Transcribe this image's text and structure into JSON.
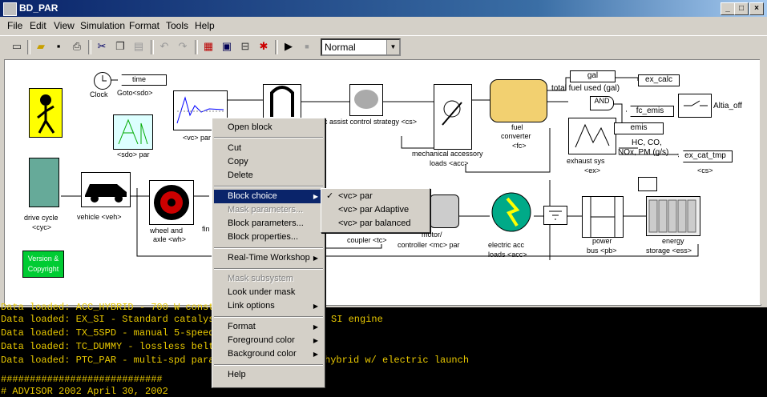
{
  "window": {
    "title": "BD_PAR",
    "minimize": "_",
    "maximize": "□",
    "close": "×"
  },
  "menubar": [
    "File",
    "Edit",
    "View",
    "Simulation",
    "Format",
    "Tools",
    "Help"
  ],
  "toolbar": {
    "mode_select": "Normal"
  },
  "blocks": {
    "clock": "Clock",
    "time": "time",
    "goto": "Goto<sdo>",
    "sdo_par": "<sdo> par",
    "vc_par": "<vc> par",
    "assist": "c assist control strategy <cs>",
    "mech_acc_1": "mechanical accessory",
    "mech_acc_2": "loads <acc>",
    "fuel_conv_1": "fuel",
    "fuel_conv_2": "converter",
    "fuel_conv_3": "<fc>",
    "gal": "gal",
    "total_fuel": "total fuel used (gal)",
    "ex_calc": "ex_calc",
    "and": "AND",
    "fc_emis": "fc_emis",
    "altia": "Altia_off",
    "emis": "emis",
    "emis_label_1": "HC, CO,",
    "emis_label_2": "NOx, PM (g/s)",
    "ex_cat_tmp": "ex_cat_tmp",
    "cs_tag": "<cs>",
    "exhaust_1": "exhaust sys",
    "exhaust_2": "<ex>",
    "drive_cycle_1": "drive cycle",
    "drive_cycle_2": "<cyc>",
    "vehicle": "vehicle <veh>",
    "wheel_1": "wheel and",
    "wheel_2": "axle <wh>",
    "fin": "fin",
    "coupler": "coupler <tc>",
    "motor_1": "motor/",
    "motor_2": "controller <mc> par",
    "elec_acc_1": "electric acc",
    "elec_acc_2": "loads <acc>",
    "power_bus_1": "power",
    "power_bus_2": "bus <pb>",
    "energy_1": "energy",
    "energy_2": "storage <ess>",
    "version_1": "Version &",
    "version_2": "Copyright"
  },
  "context_menu": {
    "items": [
      "Open block",
      "Cut",
      "Copy",
      "Delete",
      "Block choice",
      "Mask parameters...",
      "Block parameters...",
      "Block properties...",
      "Real-Time Workshop",
      "Mask subsystem",
      "Look under mask",
      "Link options",
      "Format",
      "Foreground color",
      "Background color",
      "Help"
    ]
  },
  "submenu": {
    "items": [
      "<vc> par",
      "<vc> par Adaptive",
      "<vc> par balanced"
    ],
    "checked": "✓"
  },
  "console": {
    "lines": [
      "Data loaded: ACC_HYBRID - 700 W constant",
      "Data loaded: EX_SI - Standard catalyst",
      "Data loaded: TX_5SPD - manual 5-speed",
      "Data loaded: TC_DUMMY - lossless belt",
      "Data loaded: PTC_PAR - multi-spd paral",
      "",
      "############################",
      "# ADVISOR 2002 April 30, 2002"
    ],
    "right_lines": [
      "SI engine",
      "hybrid w/ electric launch"
    ]
  },
  "colors": {
    "titlebar": "#0a246a",
    "console_text": "#e8c800",
    "version_block": "#00cc33",
    "highlight": "#0a246a"
  }
}
